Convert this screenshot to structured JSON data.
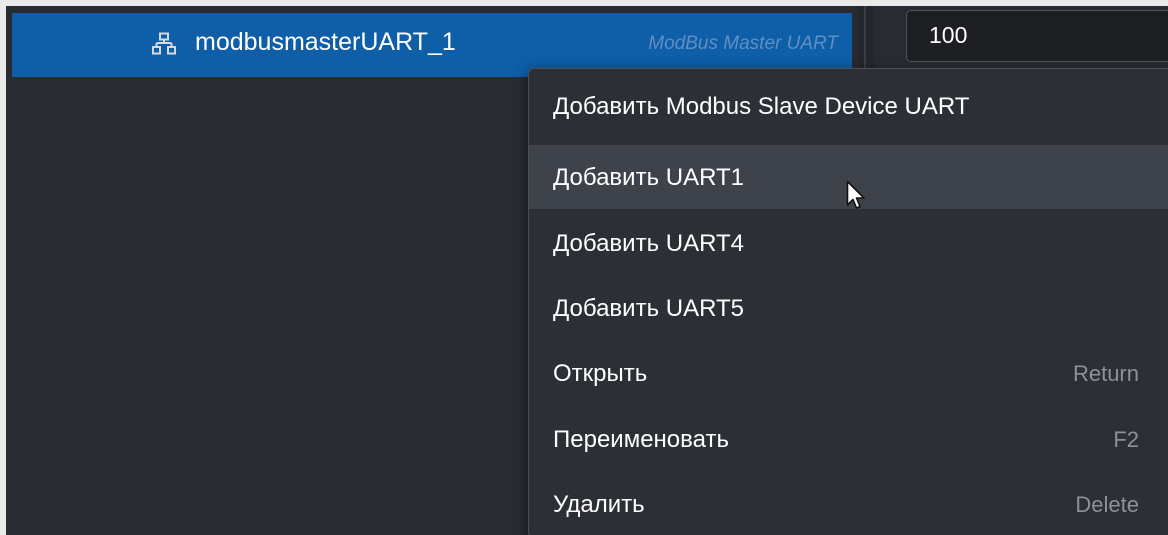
{
  "tree": {
    "selected_item": {
      "name": "modbusmasterUART_1",
      "type": "ModBus Master UART",
      "icon": "network-icon"
    }
  },
  "properties": {
    "value": "100"
  },
  "context_menu": {
    "items": [
      {
        "label": "Добавить Modbus Slave Device UART",
        "shortcut": ""
      },
      {
        "label": "Добавить UART1",
        "shortcut": ""
      },
      {
        "label": "Добавить UART4",
        "shortcut": ""
      },
      {
        "label": "Добавить UART5",
        "shortcut": ""
      },
      {
        "label": "Открыть",
        "shortcut": "Return"
      },
      {
        "label": "Переименовать",
        "shortcut": "F2"
      },
      {
        "label": "Удалить",
        "shortcut": "Delete"
      }
    ],
    "hovered_index": 1
  },
  "colors": {
    "selection": "#0e5ea8",
    "background": "#282b31",
    "menu_background": "#2c2f35",
    "menu_hover": "#3e424b"
  }
}
